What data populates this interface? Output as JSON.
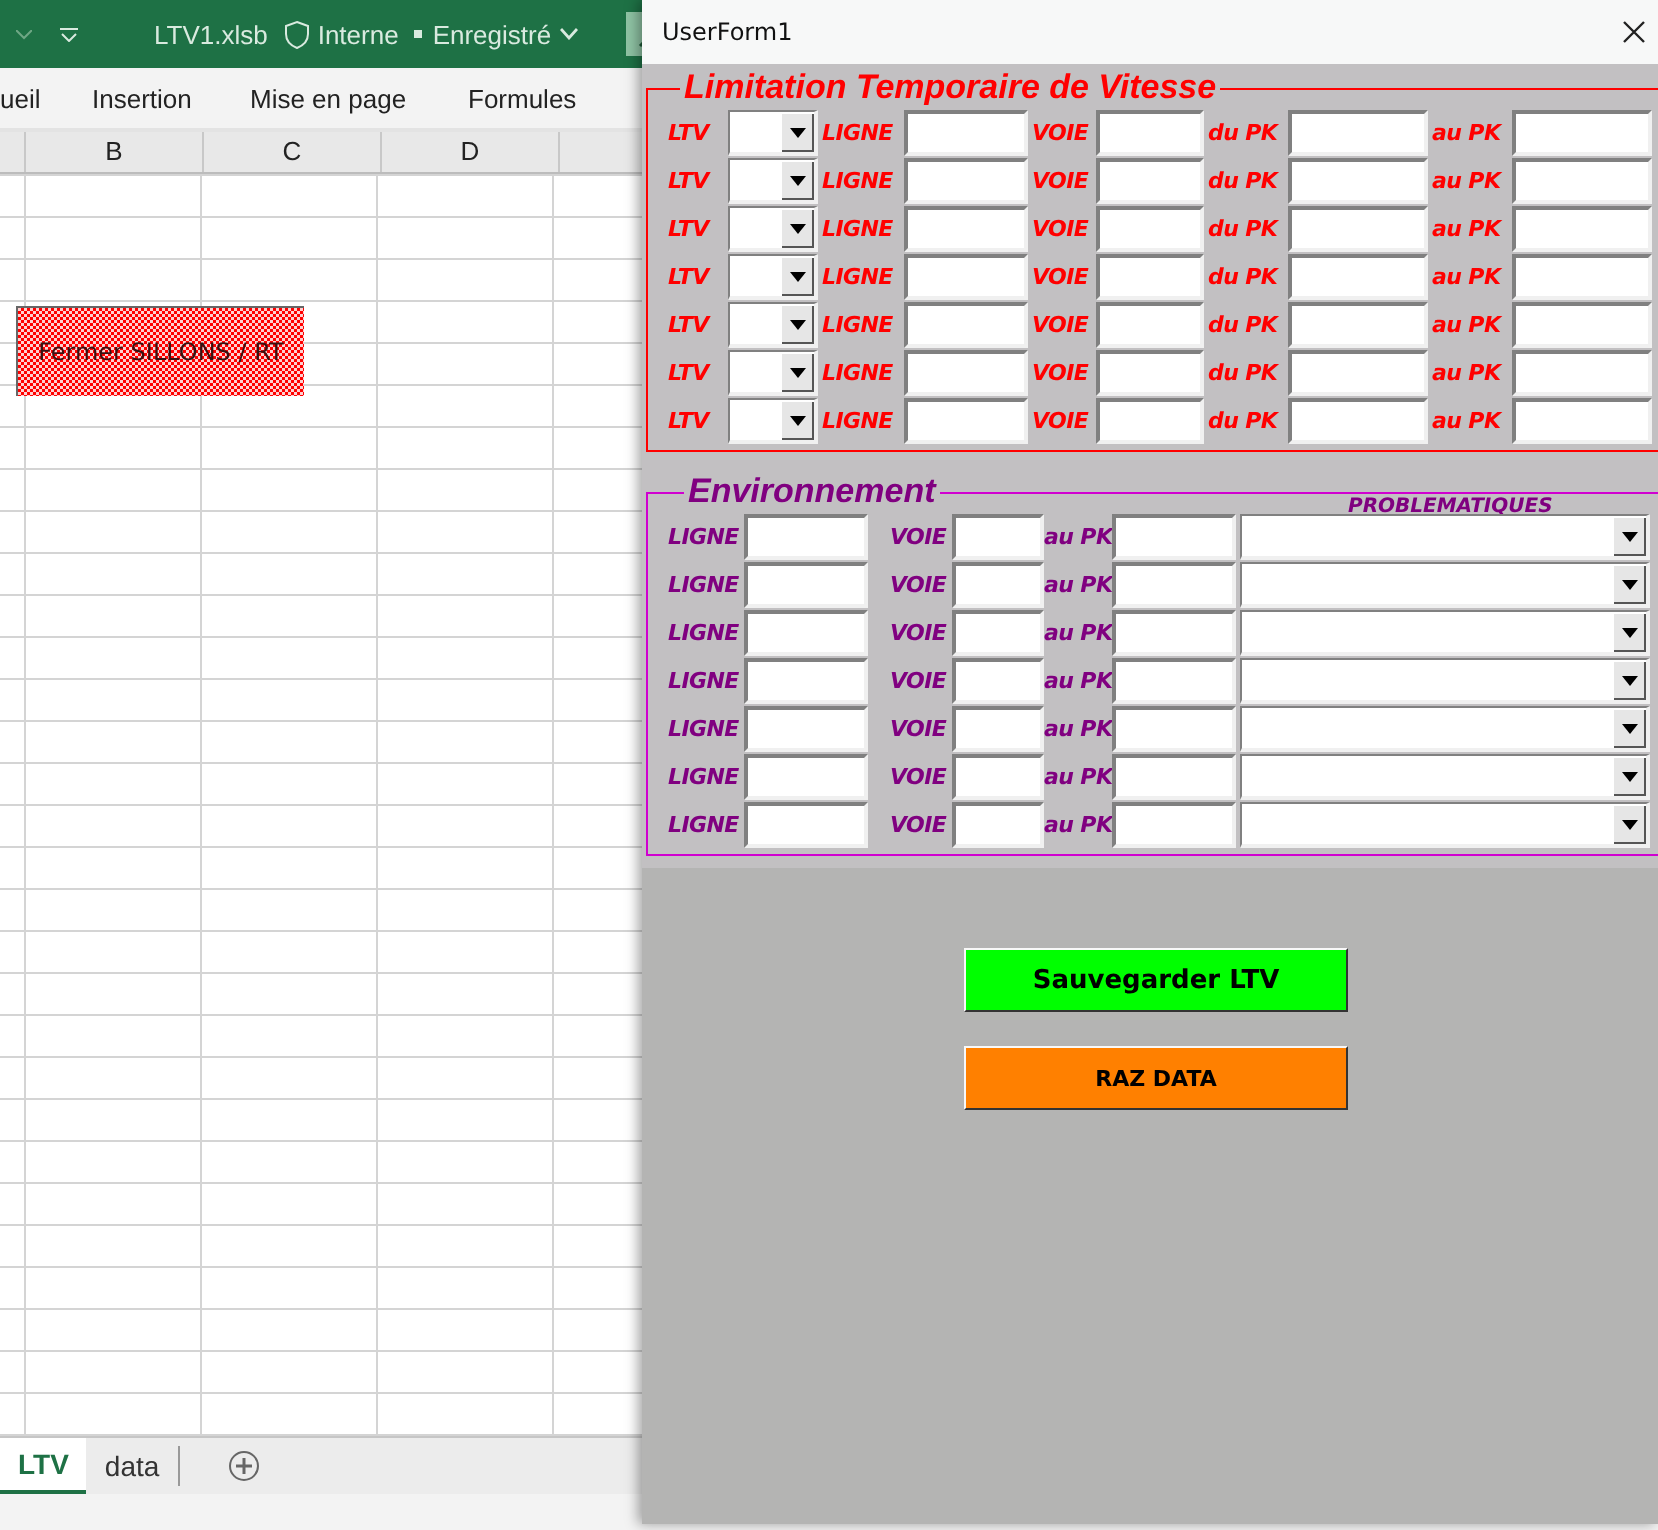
{
  "excel": {
    "file_name": "LTV1.xlsb",
    "sensitivity": "Interne",
    "save_status": "Enregistré",
    "ribbon_tabs": [
      "ueil",
      "Insertion",
      "Mise en page",
      "Formules"
    ],
    "columns": [
      "B",
      "C",
      "D"
    ],
    "shape_button": "Fermer SILLONS / RT",
    "sheet_tabs": [
      {
        "label": "LTV",
        "selected": true
      },
      {
        "label": "data",
        "selected": false
      }
    ]
  },
  "form": {
    "title": "UserForm1",
    "ltv_frame": {
      "title": "Limitation Temporaire de Vitesse",
      "rows": [
        {
          "ltv": "LTV",
          "ligne": "LIGNE",
          "voie": "VOIE",
          "du_pk": "du PK",
          "au_pk": "au PK"
        },
        {
          "ltv": "LTV",
          "ligne": "LIGNE",
          "voie": "VOIE",
          "du_pk": "du PK",
          "au_pk": "au PK"
        },
        {
          "ltv": "LTV",
          "ligne": "LIGNE",
          "voie": "VOIE",
          "du_pk": "du PK",
          "au_pk": "au PK"
        },
        {
          "ltv": "LTV",
          "ligne": "LIGNE",
          "voie": "VOIE",
          "du_pk": "du PK",
          "au_pk": "au PK"
        },
        {
          "ltv": "LTV",
          "ligne": "LIGNE",
          "voie": "VOIE",
          "du_pk": "du PK",
          "au_pk": "au PK"
        },
        {
          "ltv": "LTV",
          "ligne": "LIGNE",
          "voie": "VOIE",
          "du_pk": "du PK",
          "au_pk": "au PK"
        },
        {
          "ltv": "LTV",
          "ligne": "LIGNE",
          "voie": "VOIE",
          "du_pk": "du PK",
          "au_pk": "au PK"
        }
      ]
    },
    "env_frame": {
      "title": "Environnement",
      "column_header": "PROBLEMATIQUES",
      "rows": [
        {
          "ligne": "LIGNE",
          "voie": "VOIE",
          "au_pk": "au PK"
        },
        {
          "ligne": "LIGNE",
          "voie": "VOIE",
          "au_pk": "au PK"
        },
        {
          "ligne": "LIGNE",
          "voie": "VOIE",
          "au_pk": "au PK"
        },
        {
          "ligne": "LIGNE",
          "voie": "VOIE",
          "au_pk": "au PK"
        },
        {
          "ligne": "LIGNE",
          "voie": "VOIE",
          "au_pk": "au PK"
        },
        {
          "ligne": "LIGNE",
          "voie": "VOIE",
          "au_pk": "au PK"
        },
        {
          "ligne": "LIGNE",
          "voie": "VOIE",
          "au_pk": "au PK"
        }
      ]
    },
    "buttons": [
      {
        "label": "Sauvegarder LTV",
        "kind": "save"
      },
      {
        "label": "RAZ DATA",
        "kind": "reset"
      }
    ]
  }
}
